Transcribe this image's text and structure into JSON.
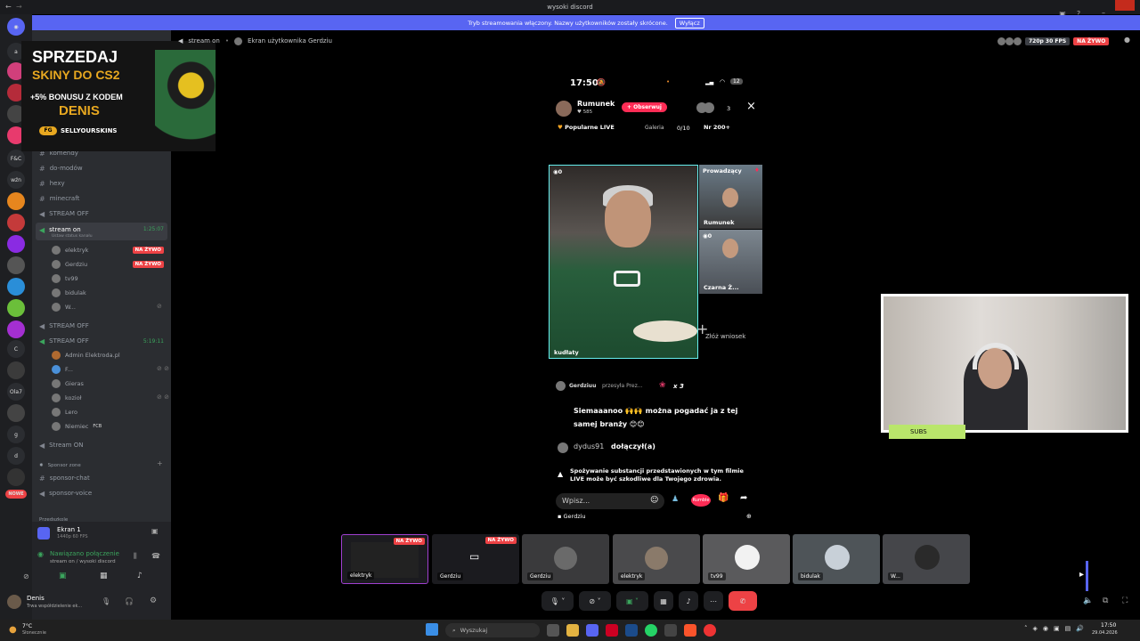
{
  "window": {
    "title": "wysoki discord"
  },
  "banner": {
    "text": "Tryb streamowania włączony. Nazwy użytkowników zostały skrócone.",
    "button": "Wyłącz"
  },
  "rail": [
    "a",
    "F&C",
    "wźn",
    "C",
    "Ola7",
    "g",
    "d",
    "NOWE"
  ],
  "sidebar": {
    "channels_text": [
      "komendy",
      "do-modów",
      "hexy",
      "minecraft"
    ],
    "categories": [
      "STREAM OFF",
      "stream on",
      "STREAM OFF",
      "STREAM OFF",
      "Stream ON"
    ],
    "stream_on_status": "Ustaw status kanału",
    "timers": [
      "1:25:07",
      "5:19:11"
    ],
    "live_label": "NA ŻYWO",
    "vc1_users": [
      "elektryk",
      "Gerdziu",
      "tv99",
      "bidulak",
      "W..."
    ],
    "vc2_users": [
      "Admin Elektroda.pl",
      "F...",
      "Gieras",
      "kozioł",
      "Lero",
      "Niemiec"
    ],
    "vc2_badge": "FCB",
    "sponsor_zone": "Sponsor zone",
    "sponsor_channels": [
      "sponsor-chat",
      "sponsor-voice"
    ],
    "przedszkole": "Przedszkole"
  },
  "ad": {
    "line1": "SPRZEDAJ",
    "line2": "SKINY DO CS2",
    "line3": "+5% BONUSU Z KODEM",
    "line4": "DENIS",
    "brand_mark": "FG",
    "brand": "SELLYOURSKINS"
  },
  "voice_header": {
    "channel": "stream on",
    "title": "Ekran użytkownika Gerdziu",
    "quality": "720p 30 FPS",
    "live": "NA ŻYWO"
  },
  "phone": {
    "time": "17:50",
    "battery": "12",
    "host": "Rumunek",
    "host_likes": "585",
    "follow_btn": "+ Obserwuj",
    "viewers": "3",
    "popular": "Popularne LIVE",
    "gallery_label": "Galeria",
    "gallery_value": "0/10",
    "rank": "Nr 200+",
    "main_count": "0",
    "main_name": "kudłaty",
    "tile_host_label": "Prowadzący",
    "tile1_name": "Rumunek",
    "tile2_count": "0",
    "tile2_name": "Czarna Ż...",
    "join_label": "Złóż wniosek",
    "gift_user": "Gerdziuu",
    "gift_text": "przesyła Prez...",
    "gift_mult": "x 3",
    "msg1": "Siemaaanoo 🙌🙌 można pogadać ja z tej samej branży 😊😊",
    "join_user": "dydus91",
    "join_text": "dołączył(a)",
    "warning": "Spożywanie substancji przedstawionych w tym filmie LIVE może być szkodliwe dla Twojego zdrowia.",
    "input_placeholder": "Wpisz...",
    "rumble": "Rumble",
    "viewer_label": "Gerdziu"
  },
  "webcam": {
    "subs_label": "SUBS"
  },
  "participants": [
    {
      "name": "elektryk",
      "live": "NA ŻYWO"
    },
    {
      "name": "Gerdziu",
      "live": "NA ŻYWO"
    },
    {
      "name": "Gerdziu",
      "live": ""
    },
    {
      "name": "elektryk",
      "live": ""
    },
    {
      "name": "tv99",
      "live": ""
    },
    {
      "name": "bidulak",
      "live": ""
    },
    {
      "name": "W...",
      "live": ""
    }
  ],
  "user_panel": {
    "screen": "Ekran 1",
    "screen_sub": "1440p 60 FPS",
    "conn": "Nawiązano połączenie",
    "conn_sub": "stream on / wysoki discord",
    "user": "Denis",
    "user_status": "Trwa współdzielenie ek..."
  },
  "taskbar": {
    "weather_temp": "7°C",
    "weather_desc": "Słonecznie",
    "search": "Wyszukaj",
    "time": "17:50",
    "date": "29.04.2026"
  },
  "colors": {
    "blurple": "#5865f2",
    "live_red": "#ed4245",
    "green": "#3ba55d"
  }
}
